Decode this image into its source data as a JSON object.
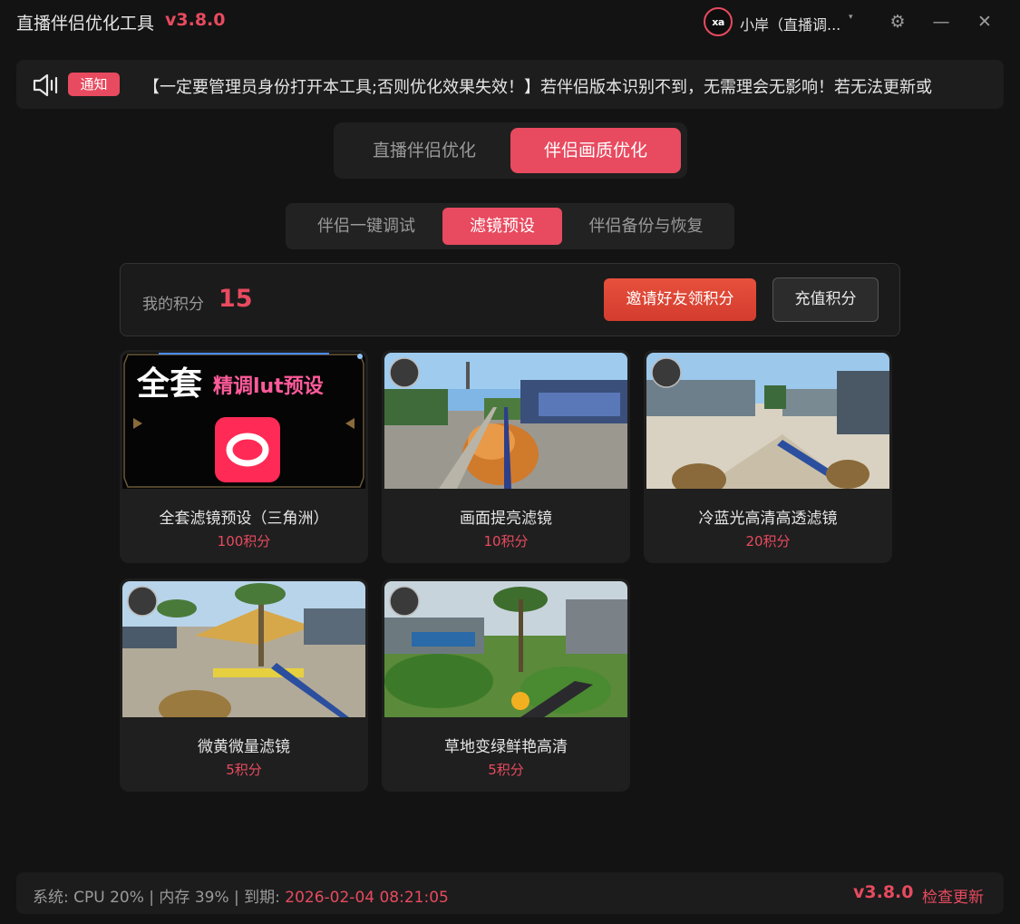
{
  "window": {
    "title": "直播伴侣优化工具",
    "version": "v3.8.0",
    "user_avatar_text": "xa",
    "user_name": "小岸（直播调...",
    "caret": "▾",
    "settings_glyph": "⚙",
    "minimize_glyph": "—",
    "close_glyph": "✕"
  },
  "notice": {
    "badge": "通知",
    "text": "【一定要管理员身份打开本工具;否则优化效果失效！】若伴侣版本识别不到，无需理会无影响！若无法更新或"
  },
  "main_tabs": [
    {
      "label": "直播伴侣优化",
      "active": false
    },
    {
      "label": "伴侣画质优化",
      "active": true
    }
  ],
  "sub_tabs": [
    {
      "label": "伴侣一键调试",
      "active": false
    },
    {
      "label": "滤镜预设",
      "active": true
    },
    {
      "label": "伴侣备份与恢复",
      "active": false
    }
  ],
  "points": {
    "label": "我的积分",
    "value": "15",
    "invite_label": "邀请好友领积分",
    "recharge_label": "充值积分"
  },
  "cards": [
    {
      "title": "全套滤镜预设（三角洲）",
      "price": "100积分",
      "promo_big": "全套",
      "promo_small": "精调lut预设"
    },
    {
      "title": "画面提亮滤镜",
      "price": "10积分"
    },
    {
      "title": "冷蓝光高清高透滤镜",
      "price": "20积分"
    },
    {
      "title": "微黄微量滤镜",
      "price": "5积分"
    },
    {
      "title": "草地变绿鲜艳高清",
      "price": "5积分"
    }
  ],
  "footer": {
    "status_prefix": "系统: CPU 20% | 内存 39% | 到期: ",
    "expiry": "2026-02-04 08:21:05",
    "version": "v3.8.0",
    "check_update": "检查更新"
  },
  "colors": {
    "accent": "#e84a5f",
    "background": "#131313",
    "panel": "#1f1f1f"
  }
}
